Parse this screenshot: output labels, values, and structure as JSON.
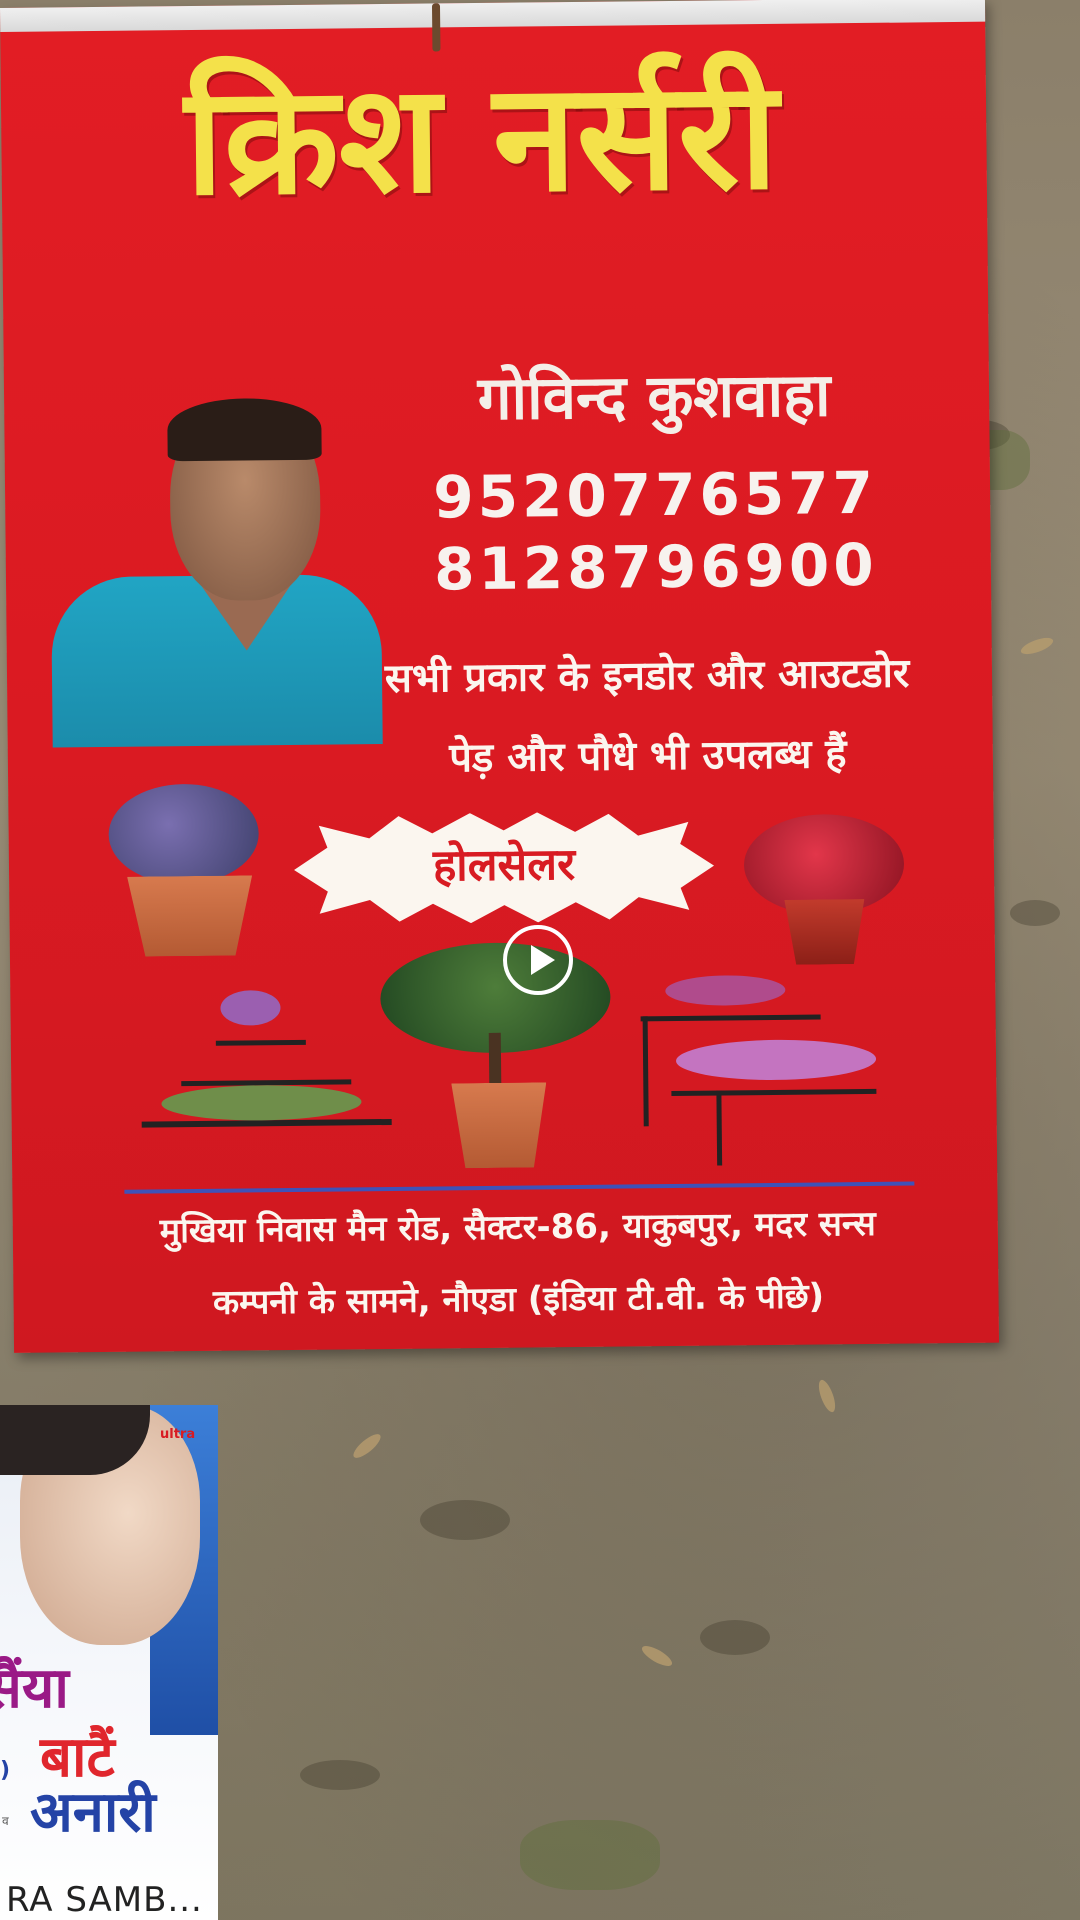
{
  "banner": {
    "title": "क्रिश नर्सरी",
    "owner": "गोविन्द कुशवाहा",
    "phones": [
      "9520776577",
      "8128796900"
    ],
    "tagline_line1": "सभी प्रकार के इनडोर और आउटडोर",
    "tagline_line2": "पेड़ और पौधे भी उपलब्ध हैं",
    "badge": "होलसेलर",
    "address_line1": "मुखिया निवास मैन रोड, सैक्टर-86, याकुबपुर, मदर सन्स",
    "address_line2": "कम्पनी के सामने, नौएडा (इंडिया टी.वी. के पीछे)"
  },
  "video": {
    "play_icon": "play-circle-icon"
  },
  "thumbnail": {
    "brand": "ultra",
    "line1": "सैंया",
    "line2": "बाटैं",
    "line3": "अनारी",
    "small_a": ")",
    "small_b": "व",
    "caption": "RA SAMB..."
  },
  "colors": {
    "banner_red": "#e21d24",
    "title_yellow": "#f4e14a",
    "text_white": "#fbf6ef",
    "shirt_teal": "#21a5c4"
  }
}
